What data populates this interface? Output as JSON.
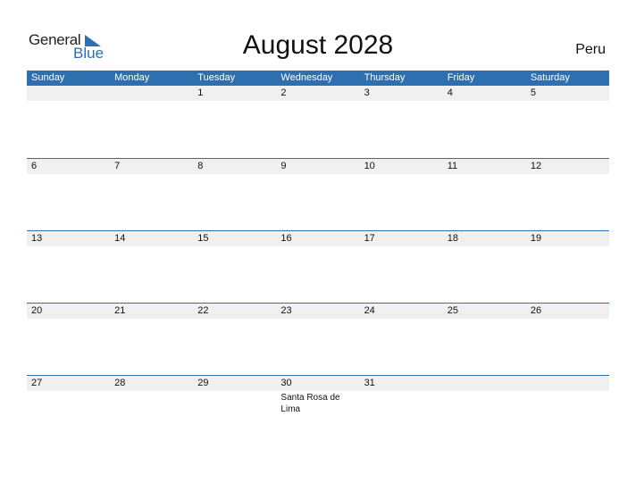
{
  "logo": {
    "general": "General",
    "blue": "Blue"
  },
  "title": "August 2028",
  "country": "Peru",
  "days": [
    "Sunday",
    "Monday",
    "Tuesday",
    "Wednesday",
    "Thursday",
    "Friday",
    "Saturday"
  ],
  "weeks": [
    {
      "dates": [
        "",
        "",
        "1",
        "2",
        "3",
        "4",
        "5"
      ],
      "events": [
        "",
        "",
        "",
        "",
        "",
        "",
        ""
      ]
    },
    {
      "dates": [
        "6",
        "7",
        "8",
        "9",
        "10",
        "11",
        "12"
      ],
      "events": [
        "",
        "",
        "",
        "",
        "",
        "",
        ""
      ]
    },
    {
      "dates": [
        "13",
        "14",
        "15",
        "16",
        "17",
        "18",
        "19"
      ],
      "events": [
        "",
        "",
        "",
        "",
        "",
        "",
        ""
      ]
    },
    {
      "dates": [
        "20",
        "21",
        "22",
        "23",
        "24",
        "25",
        "26"
      ],
      "events": [
        "",
        "",
        "",
        "",
        "",
        "",
        ""
      ]
    },
    {
      "dates": [
        "27",
        "28",
        "29",
        "30",
        "31",
        "",
        ""
      ],
      "events": [
        "",
        "",
        "",
        "Santa Rosa de Lima",
        "",
        "",
        ""
      ]
    }
  ],
  "colors": {
    "accent": "#2e6fb0",
    "strip": "#f0f0f0"
  }
}
